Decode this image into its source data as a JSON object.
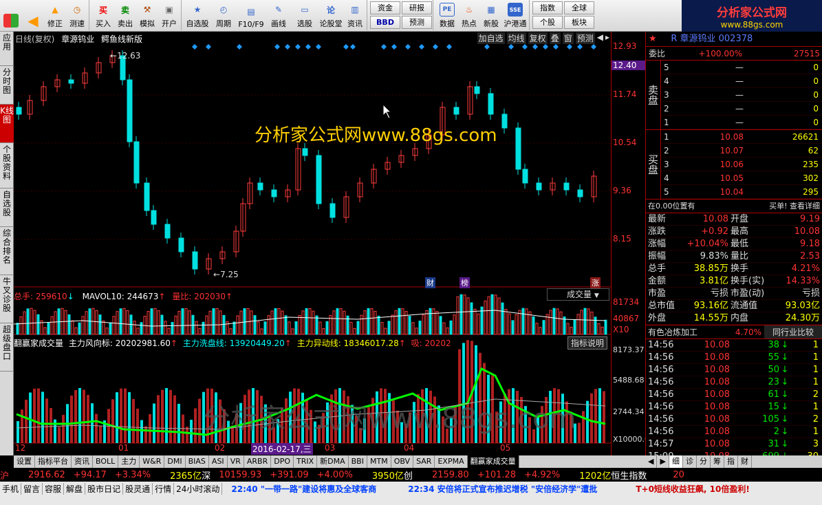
{
  "toolbar": {
    "buttons": [
      {
        "label": "",
        "icon": "windows-icon"
      },
      {
        "label": "",
        "icon": "back-arrow-icon"
      },
      {
        "label": "修正"
      },
      {
        "label": "测速"
      },
      {
        "label": "买入"
      },
      {
        "label": "卖出"
      },
      {
        "label": "模拟"
      },
      {
        "label": "开户"
      },
      {
        "label": "自选股"
      },
      {
        "label": "周期"
      },
      {
        "label": "F10/F9"
      },
      {
        "label": "画线"
      },
      {
        "label": "选股"
      },
      {
        "label": "论股堂"
      },
      {
        "label": "资讯"
      },
      {
        "label": "数据"
      },
      {
        "label": "热点"
      },
      {
        "label": "新股"
      },
      {
        "label": "沪港通"
      }
    ],
    "small_buttons_1": [
      "资金",
      "BBD"
    ],
    "small_buttons_2": [
      "研报",
      "预测"
    ],
    "small_buttons_3": [
      "指数",
      "个股"
    ],
    "small_buttons_4": [
      "全球",
      "板块"
    ],
    "icon_glyphs": {
      "buy": "买",
      "sell": "卖",
      "bracket": "[]",
      "pe": "PE",
      "info": "论"
    }
  },
  "logo": {
    "line1": "分析家公式网",
    "line2": "www.88gs.com"
  },
  "left_tabs": [
    "应用",
    "分时图",
    "K线图",
    "个股资料",
    "自选股",
    "综合排名",
    "牛叉诊股",
    "超级盘口"
  ],
  "chart": {
    "header": {
      "period": "日线(复权)",
      "stock": "章源钨业",
      "indicator": "鳄鱼线新版"
    },
    "header_buttons": [
      "加自选",
      "均线",
      "复权",
      "叠",
      "窗",
      "预测"
    ],
    "watermark": "分析家公式网www.88gs.com",
    "watermark2": "分析家公式网www.88gs.com",
    "high_label": "12.63",
    "low_label": "7.25",
    "markers": [
      "财",
      "榜",
      "涨"
    ],
    "vol_header": {
      "total": "总手: 259610",
      "mavol": "MAVOL10: 244673",
      "ratio": "量比: 202030"
    },
    "vol_select": "成交量",
    "ind_header": {
      "name": "翻赢家成交量",
      "main": "主力风向标: 20202981.60",
      "wash": "主力洗盘线: 13920449.20",
      "move": "主力异动线: 18346017.28",
      "absorb": "吸: 20202"
    },
    "ind_button": "指标说明",
    "date_labels": [
      "12",
      "01",
      "02",
      "03",
      "04",
      "05"
    ],
    "selected_date": "2016-02-17,三"
  },
  "right_axis": {
    "price": [
      "12.93",
      "12.40",
      "11.74",
      "10.54",
      "9.36",
      "8.15"
    ],
    "vol": [
      "81734",
      "40867",
      "X10"
    ],
    "ind": [
      "8173.37",
      "5488.68",
      "2744.34",
      "X10000.0"
    ]
  },
  "quote": {
    "title": "R 章源钨业 002378",
    "weibi": {
      "label": "委比",
      "value": "+100.00%",
      "right": "27515"
    },
    "sell_label": "卖盘",
    "sell": [
      {
        "n": "5",
        "p": "—",
        "v": "0"
      },
      {
        "n": "4",
        "p": "—",
        "v": "0"
      },
      {
        "n": "3",
        "p": "—",
        "v": "0"
      },
      {
        "n": "2",
        "p": "—",
        "v": "0"
      },
      {
        "n": "1",
        "p": "—",
        "v": "0"
      }
    ],
    "buy_label": "买盘",
    "buy": [
      {
        "n": "1",
        "p": "10.08",
        "v": "26621"
      },
      {
        "n": "2",
        "p": "10.07",
        "v": "62"
      },
      {
        "n": "3",
        "p": "10.06",
        "v": "235"
      },
      {
        "n": "4",
        "p": "10.05",
        "v": "302"
      },
      {
        "n": "5",
        "p": "10.04",
        "v": "295"
      }
    ],
    "position": {
      "left": "在0.00位置有",
      "right": "买单! 查看详细"
    },
    "stats": [
      {
        "k1": "最新",
        "v1": "10.08",
        "k2": "开盘",
        "v2": "9.19"
      },
      {
        "k1": "涨跌",
        "v1": "+0.92",
        "k2": "最高",
        "v2": "10.08"
      },
      {
        "k1": "涨幅",
        "v1": "+10.04%",
        "k2": "最低",
        "v2": "9.18"
      },
      {
        "k1": "振幅",
        "v1": "9.83%",
        "k2": "量比",
        "v2": "2.53"
      },
      {
        "k1": "总手",
        "v1": "38.85万",
        "k2": "换手",
        "v2": "4.21%"
      },
      {
        "k1": "金额",
        "v1": "3.81亿",
        "k2": "换手(实)",
        "v2": "14.33%"
      },
      {
        "k1": "市盈",
        "v1": "亏损",
        "k2": "市盈(动)",
        "v2": "亏损"
      },
      {
        "k1": "总市值",
        "v1": "93.16亿",
        "k2": "流通值",
        "v2": "93.03亿"
      },
      {
        "k1": "外盘",
        "v1": "14.55万",
        "k2": "内盘",
        "v2": "24.30万"
      }
    ],
    "industry": {
      "name": "有色冶炼加工",
      "pct": "4.70%",
      "btn": "同行业比较"
    },
    "ticks": [
      {
        "t": "14:56",
        "p": "10.08",
        "v": "38",
        "n": "1"
      },
      {
        "t": "14:56",
        "p": "10.08",
        "v": "55",
        "n": "1"
      },
      {
        "t": "14:56",
        "p": "10.08",
        "v": "50",
        "n": "1"
      },
      {
        "t": "14:56",
        "p": "10.08",
        "v": "23",
        "n": "1"
      },
      {
        "t": "14:56",
        "p": "10.08",
        "v": "61",
        "n": "2"
      },
      {
        "t": "14:56",
        "p": "10.08",
        "v": "15",
        "n": "1"
      },
      {
        "t": "14:56",
        "p": "10.08",
        "v": "105",
        "n": "2"
      },
      {
        "t": "14:56",
        "p": "10.08",
        "v": "2",
        "n": "1"
      },
      {
        "t": "14:57",
        "p": "10.08",
        "v": "31",
        "n": "3"
      },
      {
        "t": "15:00",
        "p": "10.08",
        "v": "699",
        "n": "30"
      }
    ]
  },
  "bottom_tabs": [
    "设置",
    "指标平台",
    "资讯",
    "BOLL",
    "主力",
    "W&R",
    "DMI",
    "BIAS",
    "ASI",
    "VR",
    "ARBR",
    "DPO",
    "TRIX",
    "新DMA",
    "BBI",
    "MTM",
    "OBV",
    "SAR",
    "EXPMA",
    "翻赢家成交量"
  ],
  "right_bottom_tabs": [
    "细",
    "诊",
    "分",
    "筹",
    "指",
    "财"
  ],
  "status": {
    "sh": "沪",
    "sh_idx": "2916.62",
    "sh_chg": "+94.17",
    "sh_pct": "+3.34%",
    "sh_amt": "2365亿",
    "sz": "深",
    "sz_idx": "10159.93",
    "sz_chg": "+391.09",
    "sz_pct": "+4.00%",
    "sz_amt": "3950亿",
    "cy": "创",
    "cy_idx": "2159.80",
    "cy_chg": "+101.28",
    "cy_pct": "+4.92%",
    "cy_amt": "1202亿",
    "hs": "恒生指数",
    "hs_val": "20"
  },
  "ticker": {
    "items": [
      "手机",
      "留言",
      "容服",
      "解盘",
      "股市日记",
      "股灵通",
      "行情",
      "24小时滚动"
    ],
    "news1": "22:40 \"一带一路\"建设将惠及全球客商",
    "news2": "22:34 安倍将正式宣布推迟增税 \"安倍经济学\"遭批",
    "news3": "T+0短线收益狂飙, 10倍盈利!"
  }
}
